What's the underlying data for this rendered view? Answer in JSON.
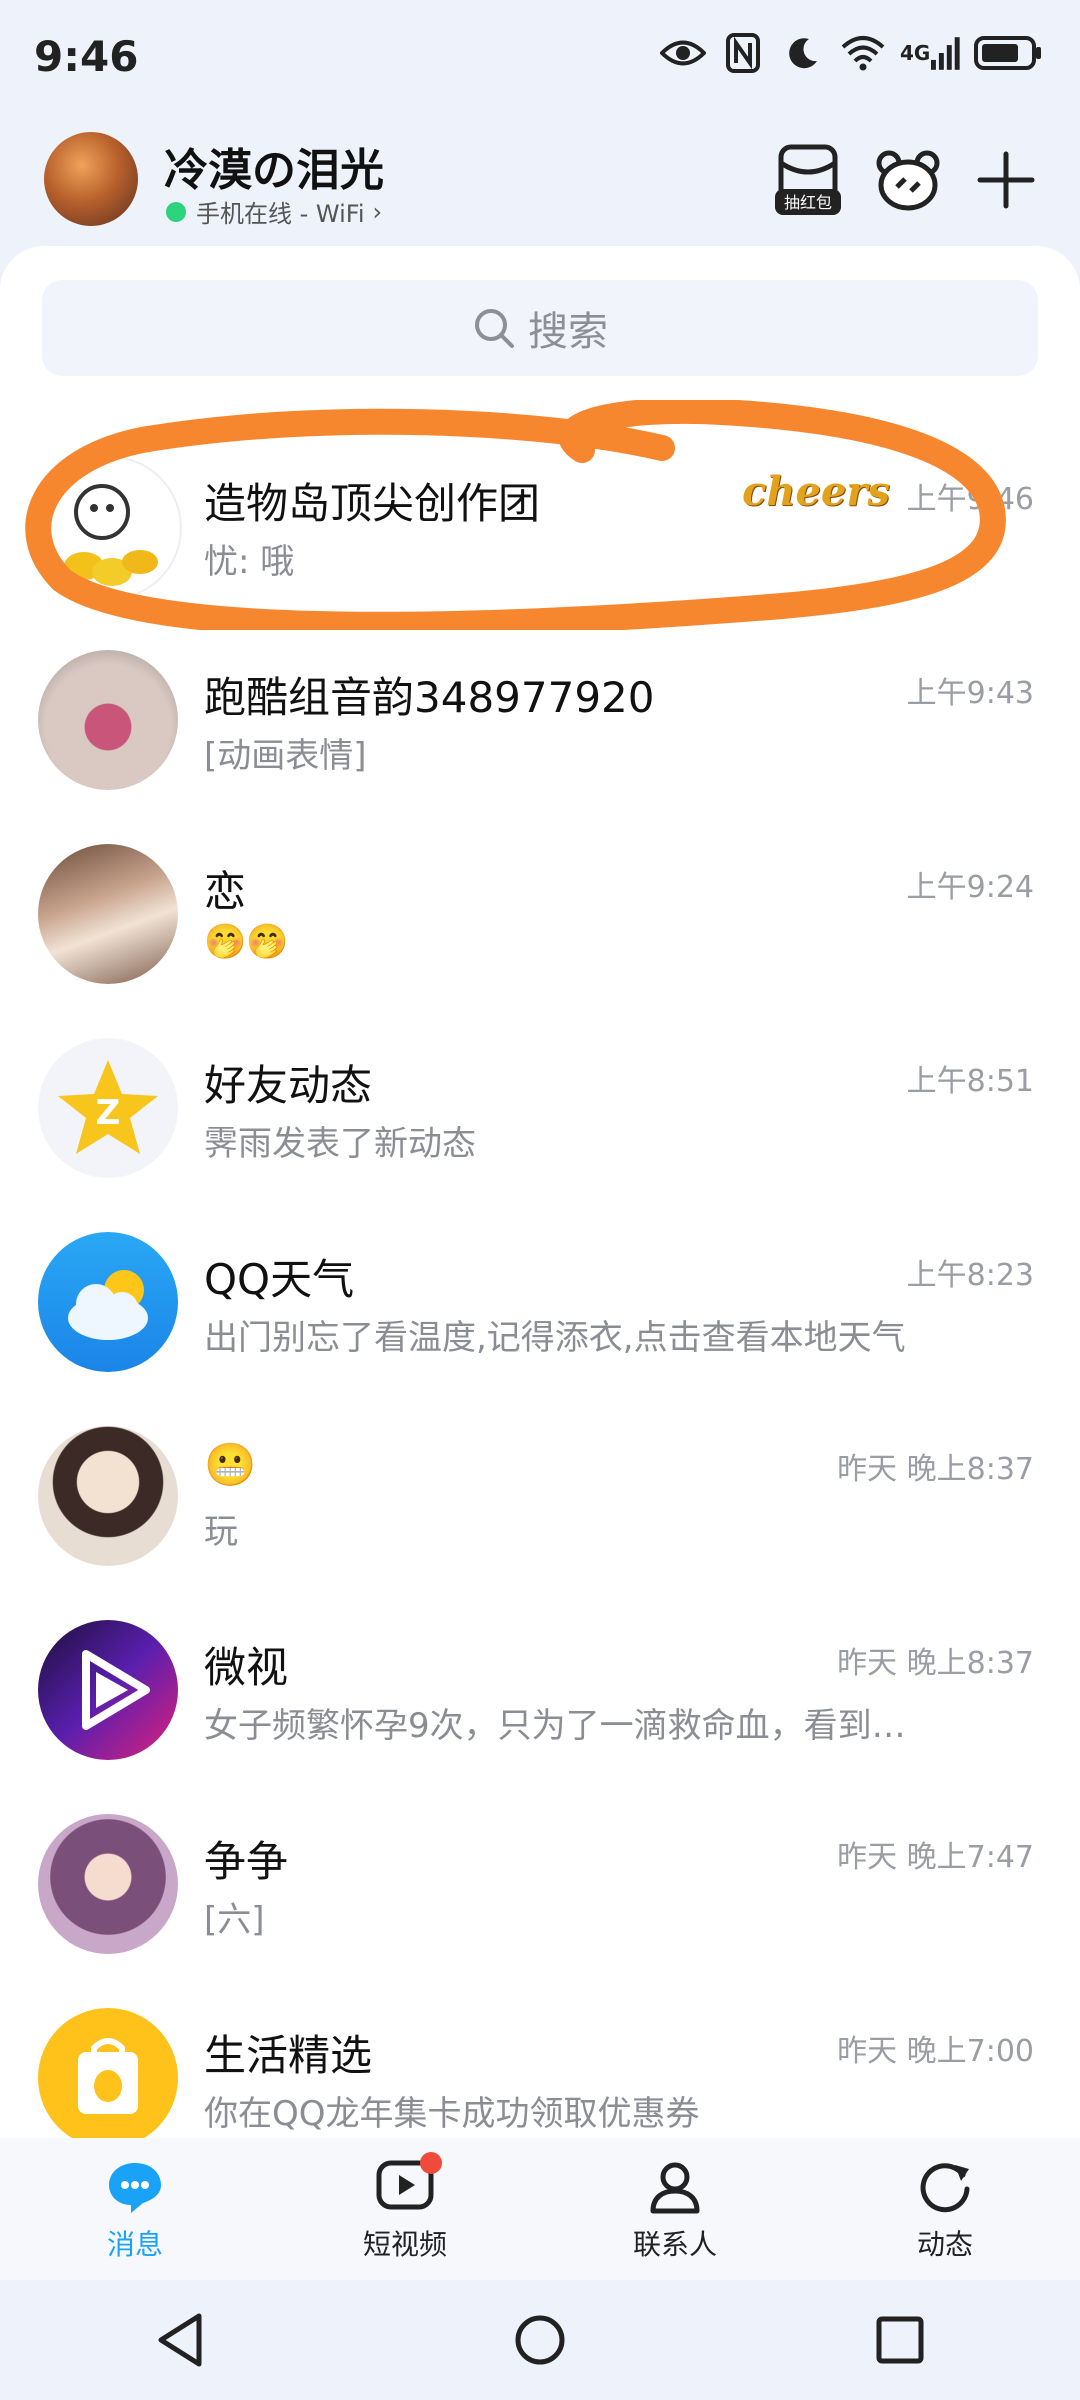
{
  "status": {
    "time": "9:46",
    "network": "4G",
    "sim_badge": "6"
  },
  "header": {
    "user_name": "冷漠の泪光",
    "online_status": "手机在线 - WiFi",
    "red_packet_label": "抽红包",
    "icons": [
      "red-packet-icon",
      "bear-icon",
      "plus-icon"
    ]
  },
  "search": {
    "placeholder": "搜索"
  },
  "chats": [
    {
      "title": "造物岛顶尖创作团",
      "message": "忧: 哦",
      "time": "上午9:46",
      "sticker": "cheers",
      "highlighted": true
    },
    {
      "title": "跑酷组音韵348977920",
      "message": "[动画表情]",
      "time": "上午9:43"
    },
    {
      "title": "恋",
      "message": "🤭🤭",
      "time": "上午9:24"
    },
    {
      "title": "好友动态",
      "message": "霁雨发表了新动态",
      "time": "上午8:51"
    },
    {
      "title": "QQ天气",
      "message": "出门别忘了看温度,记得添衣,点击查看本地天气",
      "time": "上午8:23"
    },
    {
      "title": "😬",
      "message": "玩",
      "time": "昨天 晚上8:37"
    },
    {
      "title": "微视",
      "message": "女子频繁怀孕9次，只为了一滴救命血，看到…",
      "time": "昨天 晚上8:37"
    },
    {
      "title": "争争",
      "message": "[六]",
      "time": "昨天 晚上7:47"
    },
    {
      "title": "生活精选",
      "message": "你在QQ龙年集卡成功领取优惠券",
      "time": "昨天 晚上7:00"
    }
  ],
  "tabs": [
    {
      "label": "消息",
      "icon": "message-icon",
      "active": true
    },
    {
      "label": "短视频",
      "icon": "video-icon",
      "badge": true
    },
    {
      "label": "联系人",
      "icon": "contacts-icon"
    },
    {
      "label": "动态",
      "icon": "moments-icon"
    }
  ],
  "colors": {
    "accent": "#1aa3f6",
    "highlight_stroke": "#f7872e",
    "online": "#2ed37e"
  }
}
